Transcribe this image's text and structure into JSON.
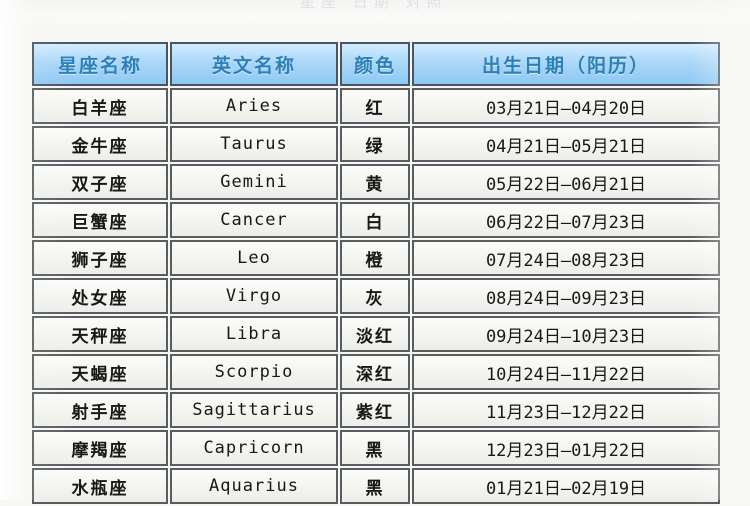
{
  "page": {
    "top_remnant_text": "星座 日期 对照",
    "background_color": "#f7f7f5"
  },
  "table": {
    "name": "zodiac-sign-reference-table",
    "header_bg_color": "#a9d4f2",
    "header_text_color": "#2f7fb5",
    "cell_bg_color": "#f1f1ee",
    "border_color": "#5a5e60",
    "columns": [
      {
        "key": "cn_name",
        "label": "星座名称"
      },
      {
        "key": "en_name",
        "label": "英文名称"
      },
      {
        "key": "color",
        "label": "颜色"
      },
      {
        "key": "birth_date",
        "label": "出生日期（阳历）"
      }
    ],
    "rows": [
      {
        "cn_name": "白羊座",
        "en_name": "Aries",
        "color": "红",
        "birth_date": "03月21日—04月20日"
      },
      {
        "cn_name": "金牛座",
        "en_name": "Taurus",
        "color": "绿",
        "birth_date": "04月21日—05月21日"
      },
      {
        "cn_name": "双子座",
        "en_name": "Gemini",
        "color": "黄",
        "birth_date": "05月22日—06月21日"
      },
      {
        "cn_name": "巨蟹座",
        "en_name": "Cancer",
        "color": "白",
        "birth_date": "06月22日—07月23日"
      },
      {
        "cn_name": "狮子座",
        "en_name": "Leo",
        "color": "橙",
        "birth_date": "07月24日—08月23日"
      },
      {
        "cn_name": "处女座",
        "en_name": "Virgo",
        "color": "灰",
        "birth_date": "08月24日—09月23日"
      },
      {
        "cn_name": "天秤座",
        "en_name": "Libra",
        "color": "淡红",
        "birth_date": "09月24日—10月23日"
      },
      {
        "cn_name": "天蝎座",
        "en_name": "Scorpio",
        "color": "深红",
        "birth_date": "10月24日—11月22日"
      },
      {
        "cn_name": "射手座",
        "en_name": "Sagittarius",
        "color": "紫红",
        "birth_date": "11月23日—12月22日"
      },
      {
        "cn_name": "摩羯座",
        "en_name": "Capricorn",
        "color": "黑",
        "birth_date": "12月23日—01月22日"
      },
      {
        "cn_name": "水瓶座",
        "en_name": "Aquarius",
        "color": "黑",
        "birth_date": "01月21日—02月19日"
      }
    ]
  }
}
